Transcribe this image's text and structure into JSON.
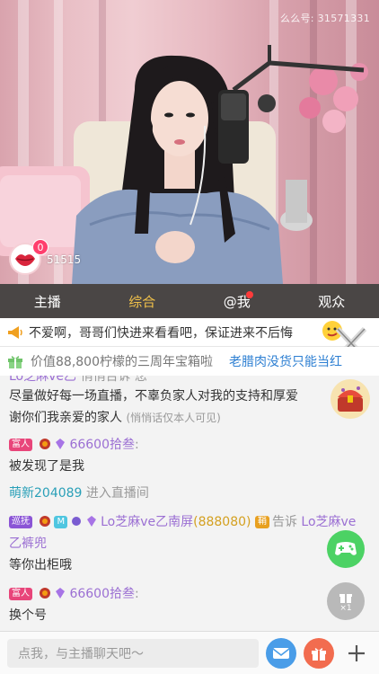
{
  "stream": {
    "room_id": "么么号: 31571331",
    "heart_count": "0",
    "viewer_count": "51515"
  },
  "tabs": [
    {
      "label": "主播",
      "active": false
    },
    {
      "label": "综合",
      "active": true
    },
    {
      "label": "@我",
      "active": false,
      "has_dot": true
    },
    {
      "label": "观众",
      "active": false
    }
  ],
  "notice": {
    "text": "不爱啊，哥哥们快进来看看吧，保证进来不后悔"
  },
  "gift_bar": {
    "text": "价值88,800柠檬的三周年宝箱啦",
    "text2": "老腊肉没货只能当红"
  },
  "chat": {
    "m0_name": "Lo芝麻ve乙",
    "m0_action": "悄悄告诉 您",
    "m1_text": "尽量做好每一场直播，不辜负家人对我的支持和厚爱",
    "m2_text": "谢你们我亲爱的家人",
    "m2_note": "(悄悄话仅本人可见)",
    "m3_badge": "富人",
    "m3_name": "66600拾叁",
    "m4_text": "被发现了是我",
    "m5_name": "萌新204089",
    "m5_action": "进入直播间",
    "m6_badge": "巡抚",
    "m6_level": "M",
    "m6_name": "Lo芝麻ve乙南屏",
    "m6_score": "(888080)",
    "m6_action": "告诉",
    "m6_target": "Lo芝麻ve",
    "m7_text": "乙裤兜",
    "m8_text": "等你出柜哦",
    "m9_badge": "富人",
    "m9_name": "66600拾叁",
    "m10_text": "换个号"
  },
  "gift_float": {
    "count": "×1"
  },
  "input": {
    "placeholder": "点我，与主播聊天吧～"
  },
  "colors": {
    "tab_bar": "#4a4645",
    "active_tab": "#f2c24a",
    "link_blue": "#2d7fd2"
  }
}
